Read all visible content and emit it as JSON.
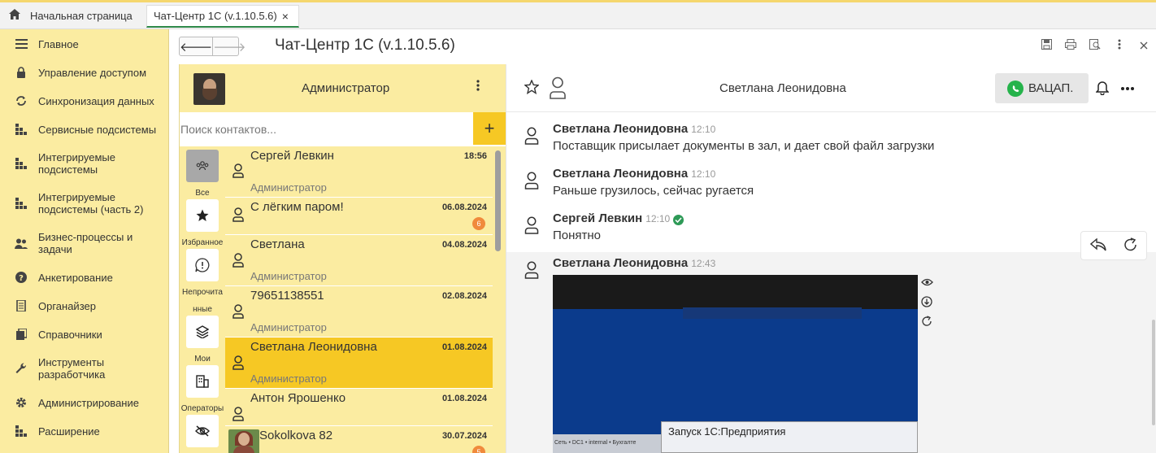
{
  "tabs": {
    "home_label": "Начальная страница",
    "doc_label": "Чат-Центр 1С  (v.1.10.5.6)",
    "close": "×"
  },
  "nav": {
    "items": [
      {
        "label": "Главное",
        "icon": "menu-icon"
      },
      {
        "label": "Управление доступом",
        "icon": "lock-icon"
      },
      {
        "label": "Синхронизация данных",
        "icon": "sync-icon"
      },
      {
        "label": "Сервисные подсистемы",
        "icon": "grid-icon"
      },
      {
        "label": "Интегрируемые подсистемы",
        "icon": "grid-icon"
      },
      {
        "label": "Интегрируемые подсистемы (часть 2)",
        "icon": "grid-icon"
      },
      {
        "label": "Бизнес-процессы и задачи",
        "icon": "users-icon"
      },
      {
        "label": "Анкетирование",
        "icon": "question-icon"
      },
      {
        "label": "Органайзер",
        "icon": "notebook-icon"
      },
      {
        "label": "Справочники",
        "icon": "books-icon"
      },
      {
        "label": "Инструменты разработчика",
        "icon": "wrench-icon"
      },
      {
        "label": "Администрирование",
        "icon": "gear-icon"
      },
      {
        "label": "Расширение",
        "icon": "grid-icon"
      }
    ]
  },
  "main": {
    "title": "Чат-Центр 1С  (v.1.10.5.6)",
    "back": "🡐",
    "forward": "🡒"
  },
  "contacts": {
    "user_name": "Администратор",
    "search_placeholder": "Поиск контактов...",
    "add": "+",
    "filters": [
      {
        "label": "Все",
        "icon": "group-icon"
      },
      {
        "label": "Избранное",
        "icon": "star-icon"
      },
      {
        "label": "Непрочита",
        "label2": "нные",
        "icon": "unread-icon"
      },
      {
        "label": "Мои",
        "icon": "layers-icon"
      },
      {
        "label": "Операторы",
        "icon": "building-icon"
      },
      {
        "label": "",
        "icon": "hidden-icon"
      }
    ],
    "list": [
      {
        "name": "Сергей Левкин",
        "date": "18:56",
        "sub": "Администратор"
      },
      {
        "name": "С лёгким паром!",
        "date": "06.08.2024",
        "sub": "",
        "badge": "6"
      },
      {
        "name": "Светлана",
        "date": "04.08.2024",
        "sub": "Администратор"
      },
      {
        "name": "79651138551",
        "date": "02.08.2024",
        "sub": "Администратор"
      },
      {
        "name": "Светлана Леонидовна",
        "date": "01.08.2024",
        "sub": "Администратор"
      },
      {
        "name": "Антон Ярошенко",
        "date": "01.08.2024",
        "sub": ""
      },
      {
        "name": "Sokolkova 82",
        "date": "30.07.2024",
        "sub": "",
        "badge": "5"
      }
    ]
  },
  "chat": {
    "title": "Светлана Леонидовна",
    "channel_button": "ВАЦАП.",
    "messages": [
      {
        "author": "Светлана Леонидовна",
        "time": "12:10",
        "text": "Поставщик присылает документы в зал, и дает свой файл загрузки"
      },
      {
        "author": "Светлана Леонидовна",
        "time": "12:10",
        "text": "Раньше грузилось, сейчас ругается"
      },
      {
        "author": "Сергей Левкин",
        "time": "12:10",
        "text": "Понятно"
      },
      {
        "author": "Светлана Леонидовна",
        "time": "12:43",
        "text": ""
      }
    ],
    "attachment": {
      "dialog_title": "Запуск 1С:Предприятия",
      "taskbar_text": "Сеть  •  DC1  •  internal  •  Бухгалте"
    }
  },
  "colors": {
    "panel_yellow": "#fbeca1",
    "accent_yellow": "#f6c824",
    "active_tab_underline": "#2f8a4a",
    "whatsapp_green": "#25b34b",
    "badge_orange": "#f08a3c"
  }
}
